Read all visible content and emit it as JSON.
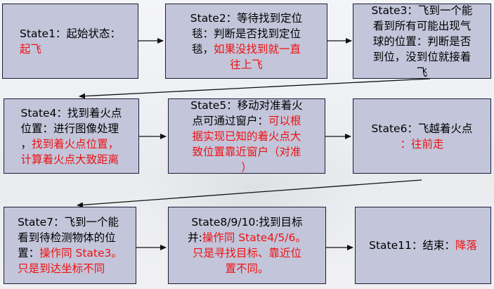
{
  "states": [
    {
      "id": "state1",
      "lines": [
        [
          {
            "t": "State1：起始状态："
          }
        ],
        [
          {
            "t": "起飞",
            "red": true
          }
        ]
      ]
    },
    {
      "id": "state2",
      "lines": [
        [
          {
            "t": "State2：等待找到定位"
          }
        ],
        [
          {
            "t": "毯：判断是否找到定位"
          }
        ],
        [
          {
            "t": "毯，"
          },
          {
            "t": "如果没找到就一直",
            "red": true
          }
        ],
        [
          {
            "t": "往上飞",
            "red": true
          }
        ]
      ]
    },
    {
      "id": "state3",
      "lines": [
        [
          {
            "t": "State3：飞到一个能"
          }
        ],
        [
          {
            "t": "看到所有可能出现气"
          }
        ],
        [
          {
            "t": "球的位置：判断是否"
          }
        ],
        [
          {
            "t": "到位，没到位就接着"
          }
        ],
        [
          {
            "t": "飞"
          }
        ]
      ]
    },
    {
      "id": "state4",
      "lines": [
        [
          {
            "t": "State4：找到着火点"
          }
        ],
        [
          {
            "t": "位置：进行图像处理"
          }
        ],
        [
          {
            "t": "，"
          },
          {
            "t": "找到着火点位置，",
            "red": true
          }
        ],
        [
          {
            "t": "计算着火点大致距离",
            "red": true
          }
        ]
      ]
    },
    {
      "id": "state5",
      "lines": [
        [
          {
            "t": "State5：移动对准着火"
          }
        ],
        [
          {
            "t": "点可通过窗户："
          },
          {
            "t": "可以根",
            "red": true
          }
        ],
        [
          {
            "t": "据实现已知的着火点大",
            "red": true
          }
        ],
        [
          {
            "t": "致位置靠近窗户（对准",
            "red": true
          }
        ],
        [
          {
            "t": "）",
            "red": true
          }
        ]
      ]
    },
    {
      "id": "state6",
      "lines": [
        [
          {
            "t": "State6：飞越着火点"
          }
        ],
        [
          {
            "t": "：往前走",
            "red": true
          }
        ]
      ]
    },
    {
      "id": "state7",
      "lines": [
        [
          {
            "t": "State7：飞到一个能"
          }
        ],
        [
          {
            "t": "看到待检测物体的位"
          }
        ],
        [
          {
            "t": "置："
          },
          {
            "t": "操作同 State3。",
            "red": true
          }
        ],
        [
          {
            "t": "只是到达坐标不同",
            "red": true
          }
        ]
      ]
    },
    {
      "id": "state8",
      "lines": [
        [
          {
            "t": "State8/9/10:找到目标"
          }
        ],
        [
          {
            "t": "并:"
          },
          {
            "t": "操作同 State4/5/6。",
            "red": true
          }
        ],
        [
          {
            "t": "只是寻找目标、靠近位",
            "red": true
          }
        ],
        [
          {
            "t": "置不同。",
            "red": true
          }
        ]
      ]
    },
    {
      "id": "state11",
      "lines": [
        [
          {
            "t": "State11：结束："
          },
          {
            "t": "降落",
            "red": true
          }
        ]
      ]
    }
  ],
  "colors": {
    "box_fill": "#c3c5da",
    "box_border": "#1c1c3a",
    "highlight": "#ee1111",
    "arrow": "#111111"
  }
}
